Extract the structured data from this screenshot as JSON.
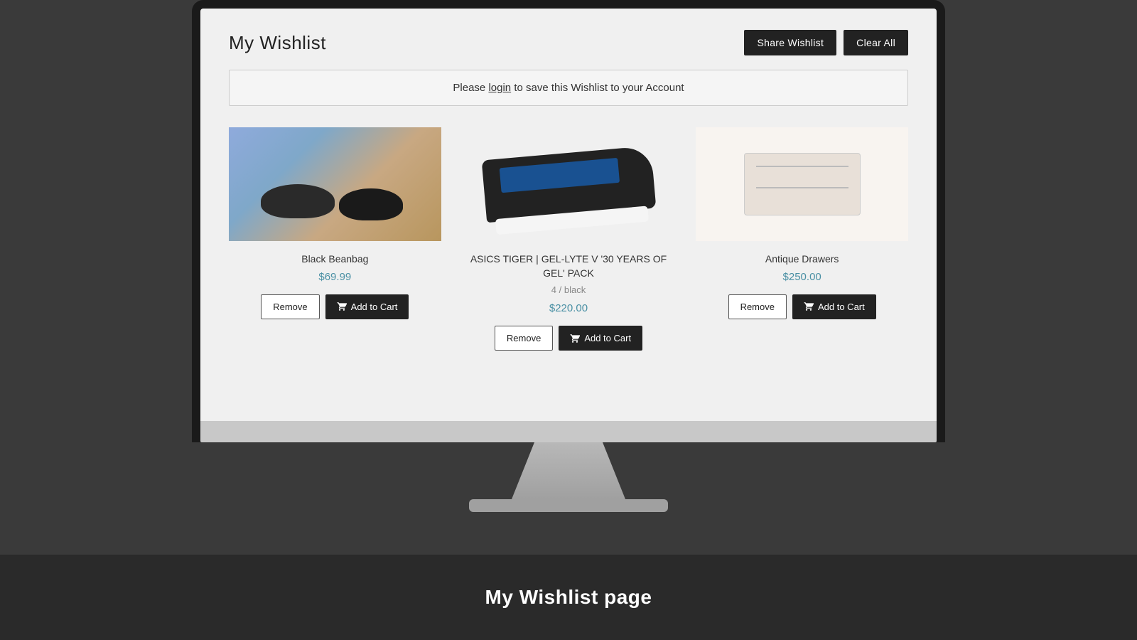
{
  "page": {
    "title": "My Wishlist",
    "bottom_label": "My Wishlist page"
  },
  "header": {
    "share_label": "Share Wishlist",
    "clear_label": "Clear All"
  },
  "notice": {
    "text_prefix": "Please ",
    "login_text": "login",
    "text_suffix": " to save this Wishlist to your Account"
  },
  "products": [
    {
      "id": 1,
      "name": "Black Beanbag",
      "variant": "",
      "price": "$69.99",
      "image_type": "beanbag",
      "remove_label": "Remove",
      "add_cart_label": "Add to Cart"
    },
    {
      "id": 2,
      "name": "ASICS TIGER | GEL-LYTE V '30 YEARS OF GEL' PACK",
      "variant": "4 / black",
      "price": "$220.00",
      "image_type": "shoe",
      "remove_label": "Remove",
      "add_cart_label": "Add to Cart"
    },
    {
      "id": 3,
      "name": "Antique Drawers",
      "variant": "",
      "price": "$250.00",
      "image_type": "drawers",
      "remove_label": "Remove",
      "add_cart_label": "Add to Cart"
    }
  ]
}
